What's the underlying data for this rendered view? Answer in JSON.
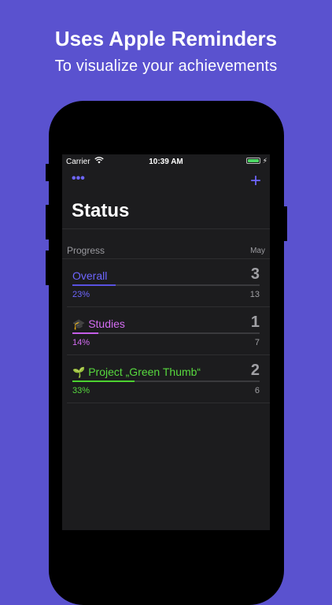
{
  "promo": {
    "headline": "Uses Apple Reminders",
    "subline": "To visualize your achievements"
  },
  "statusbar": {
    "carrier": "Carrier",
    "time": "10:39 AM",
    "battery_level": 1.0
  },
  "nav": {
    "more_icon": "ellipsis-icon",
    "more_glyph": "•••",
    "add_icon": "plus-icon",
    "add_glyph": "+"
  },
  "page": {
    "title": "Status"
  },
  "section": {
    "label": "Progress",
    "period": "May"
  },
  "rows": [
    {
      "emoji": "",
      "name": "Overall",
      "count": "3",
      "percent": "23%",
      "total": "13",
      "progress": 0.23,
      "color": "#6e66ff",
      "bar_color": "#5a52e0"
    },
    {
      "emoji": "🎓",
      "name": "Studies",
      "count": "1",
      "percent": "14%",
      "total": "7",
      "progress": 0.14,
      "color": "#d36cf2",
      "bar_color": "#c45ee8"
    },
    {
      "emoji": "🌱",
      "name": "Project „Green Thumb“",
      "count": "2",
      "percent": "33%",
      "total": "6",
      "progress": 0.33,
      "color": "#57d93e",
      "bar_color": "#4cd130"
    }
  ],
  "colors": {
    "background": "#5a52cf",
    "screen": "#1c1c1e",
    "accent": "#6e66ff"
  }
}
